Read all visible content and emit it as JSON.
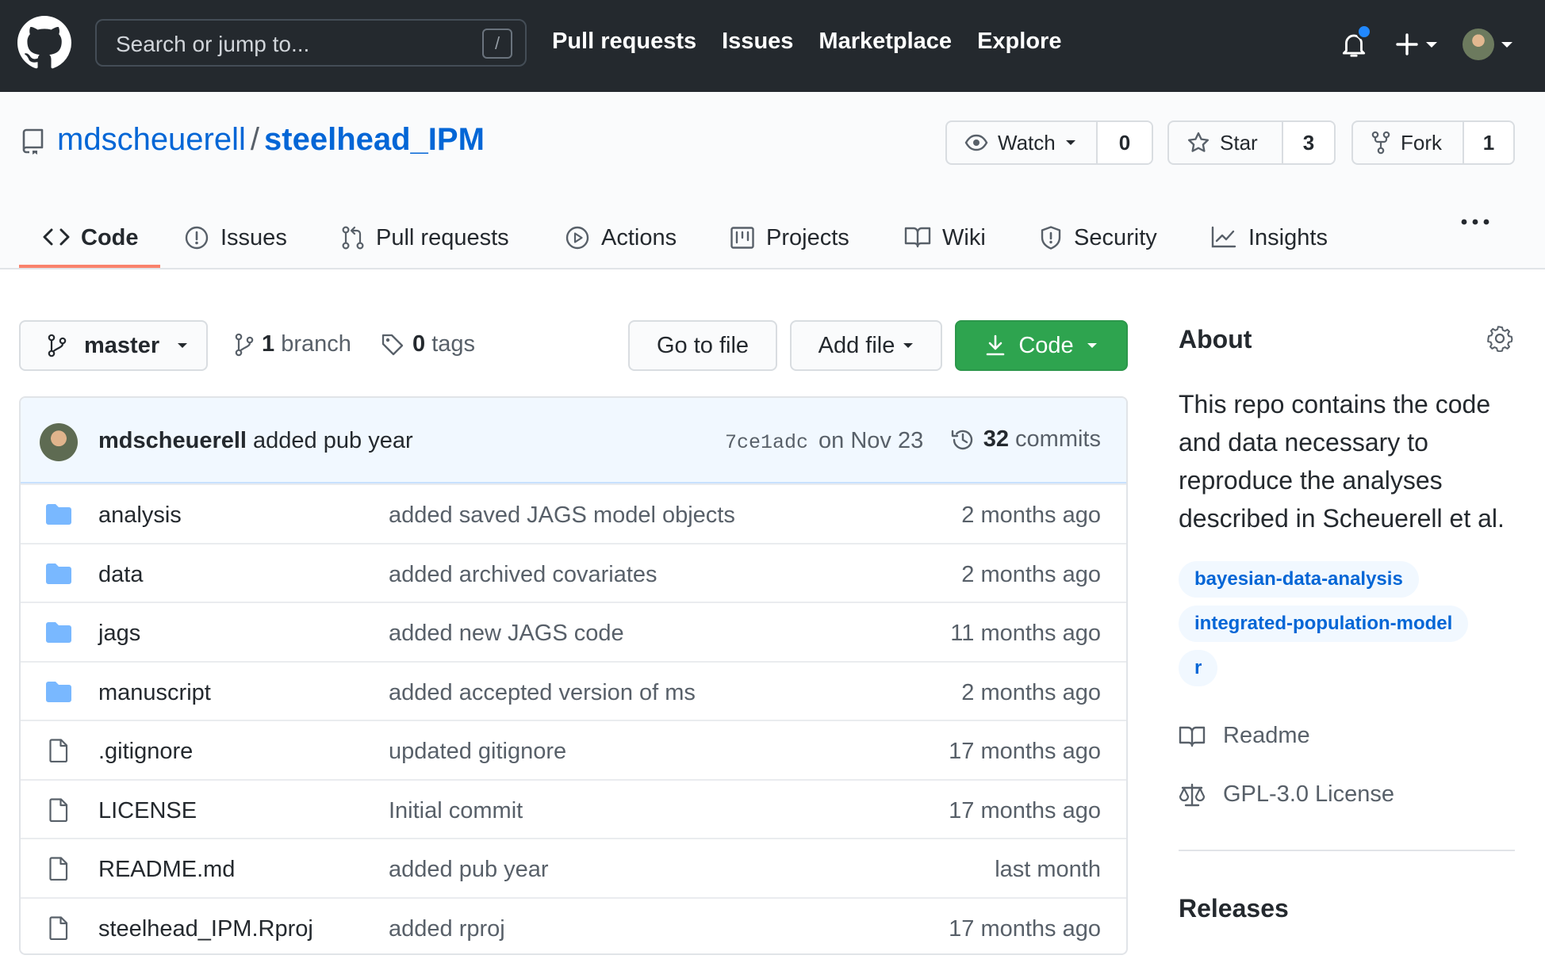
{
  "header": {
    "search_placeholder": "Search or jump to...",
    "search_shortcut": "/",
    "nav": [
      "Pull requests",
      "Issues",
      "Marketplace",
      "Explore"
    ]
  },
  "repo": {
    "owner": "mdscheuerell",
    "separator": "/",
    "name": "steelhead_IPM",
    "watch_label": "Watch",
    "watch_count": "0",
    "star_label": "Star",
    "star_count": "3",
    "fork_label": "Fork",
    "fork_count": "1"
  },
  "tabs": [
    {
      "label": "Code",
      "icon": "code-icon",
      "active": true
    },
    {
      "label": "Issues",
      "icon": "issue-opened-icon"
    },
    {
      "label": "Pull requests",
      "icon": "git-pull-request-icon"
    },
    {
      "label": "Actions",
      "icon": "play-icon"
    },
    {
      "label": "Projects",
      "icon": "project-icon"
    },
    {
      "label": "Wiki",
      "icon": "book-icon"
    },
    {
      "label": "Security",
      "icon": "shield-icon"
    },
    {
      "label": "Insights",
      "icon": "graph-icon"
    }
  ],
  "toolbar": {
    "branch_name": "master",
    "branch_count": "1",
    "branch_word": "branch",
    "tag_count": "0",
    "tag_word": "tags",
    "go_to_file": "Go to file",
    "add_file": "Add file",
    "code": "Code"
  },
  "commit": {
    "author": "mdscheuerell",
    "message": "added pub year",
    "sha": "7ce1adc",
    "date": "on Nov 23",
    "count": "32",
    "count_word": "commits"
  },
  "files": [
    {
      "type": "dir",
      "name": "analysis",
      "message": "added saved JAGS model objects",
      "age": "2 months ago"
    },
    {
      "type": "dir",
      "name": "data",
      "message": "added archived covariates",
      "age": "2 months ago"
    },
    {
      "type": "dir",
      "name": "jags",
      "message": "added new JAGS code",
      "age": "11 months ago"
    },
    {
      "type": "dir",
      "name": "manuscript",
      "message": "added accepted version of ms",
      "age": "2 months ago"
    },
    {
      "type": "file",
      "name": ".gitignore",
      "message": "updated gitignore",
      "age": "17 months ago"
    },
    {
      "type": "file",
      "name": "LICENSE",
      "message": "Initial commit",
      "age": "17 months ago"
    },
    {
      "type": "file",
      "name": "README.md",
      "message": "added pub year",
      "age": "last month"
    },
    {
      "type": "file",
      "name": "steelhead_IPM.Rproj",
      "message": "added rproj",
      "age": "17 months ago"
    }
  ],
  "about": {
    "heading": "About",
    "description": "This repo contains the code and data necessary to reproduce the analyses described in Scheuerell et al.",
    "topics": [
      "bayesian-data-analysis",
      "integrated-population-model",
      "r"
    ],
    "readme": "Readme",
    "license": "GPL-3.0 License",
    "releases_heading": "Releases"
  },
  "colors": {
    "header_bg": "#24292e",
    "link": "#0366d6",
    "primary_button": "#2ea44f",
    "active_tab_underline": "#f9826c",
    "folder_icon": "#79b8ff",
    "notification_dot": "#2188ff"
  }
}
